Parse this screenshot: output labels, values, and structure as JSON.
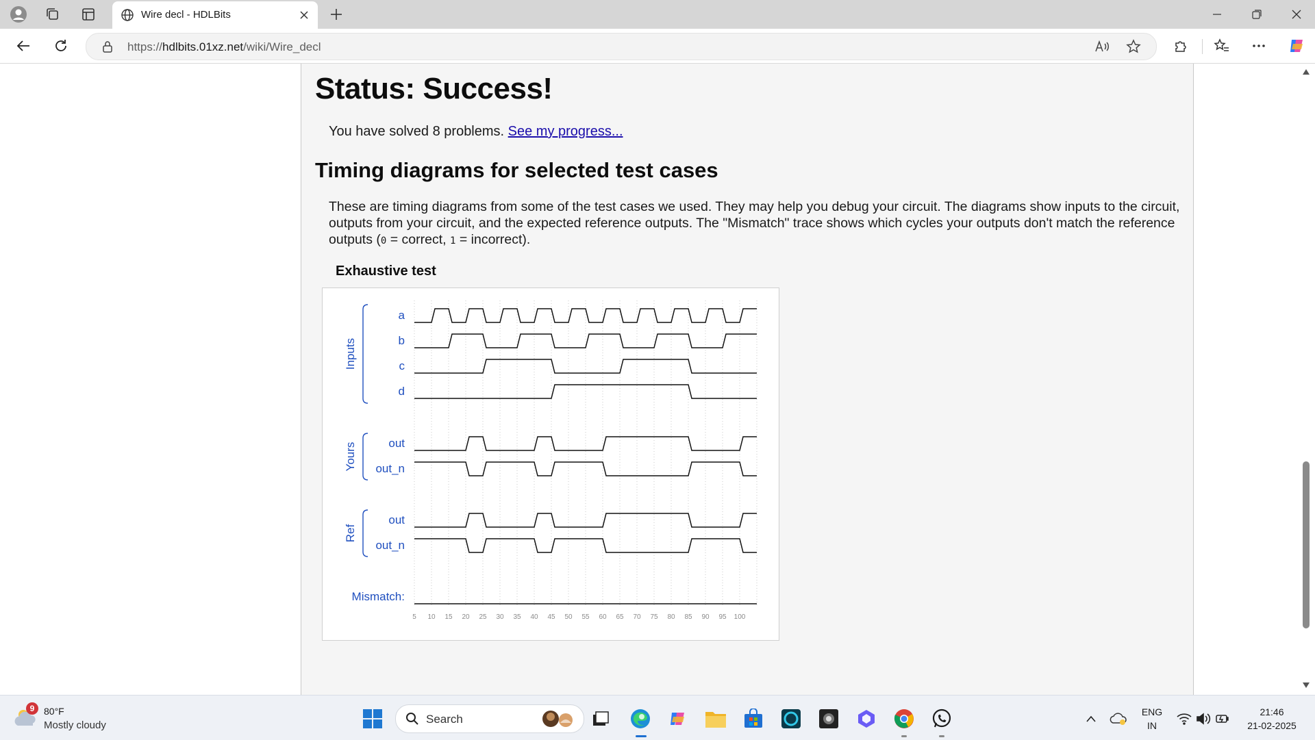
{
  "browser": {
    "tab_title": "Wire decl - HDLBits",
    "url_prefix": "https://",
    "url_host": "hdlbits.01xz.net",
    "url_path": "/wiki/Wire_decl"
  },
  "page": {
    "status_heading": "Status: Success!",
    "solved_text": "You have solved 8 problems.",
    "progress_link": "See my progress...",
    "timing_heading": "Timing diagrams for selected test cases",
    "para_part1": "These are timing diagrams from some of the test cases we used. They may help you debug your circuit. The diagrams show inputs to the circuit, outputs from your circuit, and the expected reference outputs. The \"Mismatch\" trace shows which cycles your outputs don't match the reference outputs (",
    "para_code0": "0",
    "para_part2": " = correct, ",
    "para_code1": "1",
    "para_part3": " = incorrect).",
    "test_heading": "Exhaustive test"
  },
  "diagram": {
    "group_inputs": "Inputs",
    "group_yours": "Yours",
    "group_ref": "Ref",
    "mismatch_label": "Mismatch:",
    "signals": [
      {
        "name": "a",
        "group": "inputs",
        "values": [
          0,
          1,
          0,
          1,
          0,
          1,
          0,
          1,
          0,
          1,
          0,
          1,
          0,
          1,
          0,
          1,
          0,
          1,
          0,
          1
        ]
      },
      {
        "name": "b",
        "group": "inputs",
        "values": [
          0,
          0,
          1,
          1,
          0,
          0,
          1,
          1,
          0,
          0,
          1,
          1,
          0,
          0,
          1,
          1,
          0,
          0,
          1,
          1
        ]
      },
      {
        "name": "c",
        "group": "inputs",
        "values": [
          0,
          0,
          0,
          0,
          1,
          1,
          1,
          1,
          0,
          0,
          0,
          0,
          1,
          1,
          1,
          1,
          0,
          0,
          0,
          0
        ]
      },
      {
        "name": "d",
        "group": "inputs",
        "values": [
          0,
          0,
          0,
          0,
          0,
          0,
          0,
          0,
          1,
          1,
          1,
          1,
          1,
          1,
          1,
          1,
          0,
          0,
          0,
          0
        ]
      },
      {
        "name": "out",
        "group": "yours",
        "values": [
          0,
          0,
          0,
          1,
          0,
          0,
          0,
          1,
          0,
          0,
          0,
          1,
          1,
          1,
          1,
          1,
          0,
          0,
          0,
          1
        ]
      },
      {
        "name": "out_n",
        "group": "yours",
        "values": [
          1,
          1,
          1,
          0,
          1,
          1,
          1,
          0,
          1,
          1,
          1,
          0,
          0,
          0,
          0,
          0,
          1,
          1,
          1,
          0
        ]
      },
      {
        "name": "out",
        "group": "ref",
        "values": [
          0,
          0,
          0,
          1,
          0,
          0,
          0,
          1,
          0,
          0,
          0,
          1,
          1,
          1,
          1,
          1,
          0,
          0,
          0,
          1
        ]
      },
      {
        "name": "out_n",
        "group": "ref",
        "values": [
          1,
          1,
          1,
          0,
          1,
          1,
          1,
          0,
          1,
          1,
          1,
          0,
          0,
          0,
          0,
          0,
          1,
          1,
          1,
          0
        ]
      },
      {
        "name": "mismatch",
        "group": "mismatch",
        "values": [
          0,
          0,
          0,
          0,
          0,
          0,
          0,
          0,
          0,
          0,
          0,
          0,
          0,
          0,
          0,
          0,
          0,
          0,
          0,
          0
        ]
      }
    ],
    "tick_labels": [
      "5",
      "10",
      "15",
      "20",
      "25",
      "30",
      "35",
      "40",
      "45",
      "50",
      "55",
      "60",
      "65",
      "70",
      "75",
      "80",
      "85",
      "90",
      "95",
      "100"
    ],
    "colors": {
      "label": "#1f4fbf",
      "trace": "#111111",
      "grid": "#c8c8c8",
      "tick": "#8a8a8a"
    }
  },
  "taskbar": {
    "weather_badge": "9",
    "weather_temp": "80°F",
    "weather_desc": "Mostly cloudy",
    "search_placeholder": "Search",
    "lang_line1": "ENG",
    "lang_line2": "IN",
    "time": "21:46",
    "date": "21-02-2025"
  }
}
